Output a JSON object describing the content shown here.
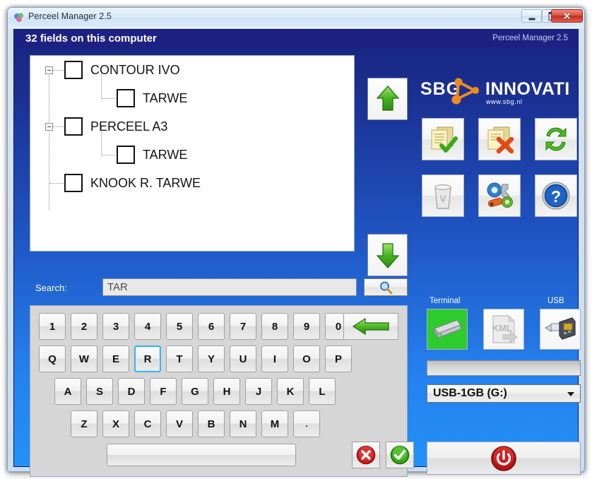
{
  "window": {
    "title": "Perceel Manager 2.5",
    "icon": "app-circles-icon",
    "minimize_label": "",
    "maximize_label": "",
    "close_label": ""
  },
  "header": {
    "title": "32 fields on this computer",
    "right_title": "Perceel Manager 2.5"
  },
  "brand": {
    "name_left": "SBG",
    "name_right": "INNOVATIE",
    "url": "www.sbg.nl",
    "accent_color": "#f08a1e"
  },
  "tree": {
    "items": [
      {
        "label": "CONTOUR IVO",
        "level": 0,
        "checked": false,
        "expanded": true
      },
      {
        "label": "TARWE",
        "level": 1,
        "checked": false,
        "expanded": false
      },
      {
        "label": "PERCEEL A3",
        "level": 0,
        "checked": false,
        "expanded": true
      },
      {
        "label": "TARWE",
        "level": 1,
        "checked": false,
        "expanded": false
      },
      {
        "label": "KNOOK R. TARWE",
        "level": 0,
        "checked": false,
        "expanded": false
      }
    ]
  },
  "scroll": {
    "up_icon": "green-up-arrow-icon",
    "down_icon": "green-down-arrow-icon"
  },
  "toolbar": {
    "buttons": [
      {
        "name": "select-all-button",
        "icon": "documents-check-icon"
      },
      {
        "name": "deselect-all-button",
        "icon": "documents-delete-icon"
      },
      {
        "name": "refresh-button",
        "icon": "green-refresh-icon"
      },
      {
        "name": "trash-button",
        "icon": "recycle-bin-icon"
      },
      {
        "name": "settings-button",
        "icon": "gears-wrench-icon"
      },
      {
        "name": "help-button",
        "icon": "blue-question-icon"
      }
    ]
  },
  "search": {
    "label": "Search:",
    "value": "TAR",
    "placeholder": "",
    "button_icon": "magnifier-icon"
  },
  "keyboard": {
    "row_numbers": [
      "1",
      "2",
      "3",
      "4",
      "5",
      "6",
      "7",
      "8",
      "9",
      "0"
    ],
    "row_top": [
      "Q",
      "W",
      "E",
      "R",
      "T",
      "Y",
      "U",
      "I",
      "O",
      "P"
    ],
    "row_home": [
      "A",
      "S",
      "D",
      "F",
      "G",
      "H",
      "J",
      "K",
      "L"
    ],
    "row_bottom": [
      "Z",
      "X",
      "C",
      "V",
      "B",
      "N",
      "M",
      "."
    ],
    "focused_key": "R",
    "backspace_icon": "green-left-arrow-icon",
    "space_label": "",
    "cancel_icon": "red-x-circle-icon",
    "ok_icon": "green-check-circle-icon"
  },
  "transfer": {
    "terminal_label": "Terminal",
    "usb_label": "USB",
    "terminal_icon": "hard-drive-icon",
    "kml_icon": "kml-export-icon",
    "kml_text": "KML",
    "usb_icon": "usb-stick-icon",
    "progress_value": 0,
    "drive_selected": "USB-1GB (G:)",
    "exit_icon": "red-power-icon"
  }
}
